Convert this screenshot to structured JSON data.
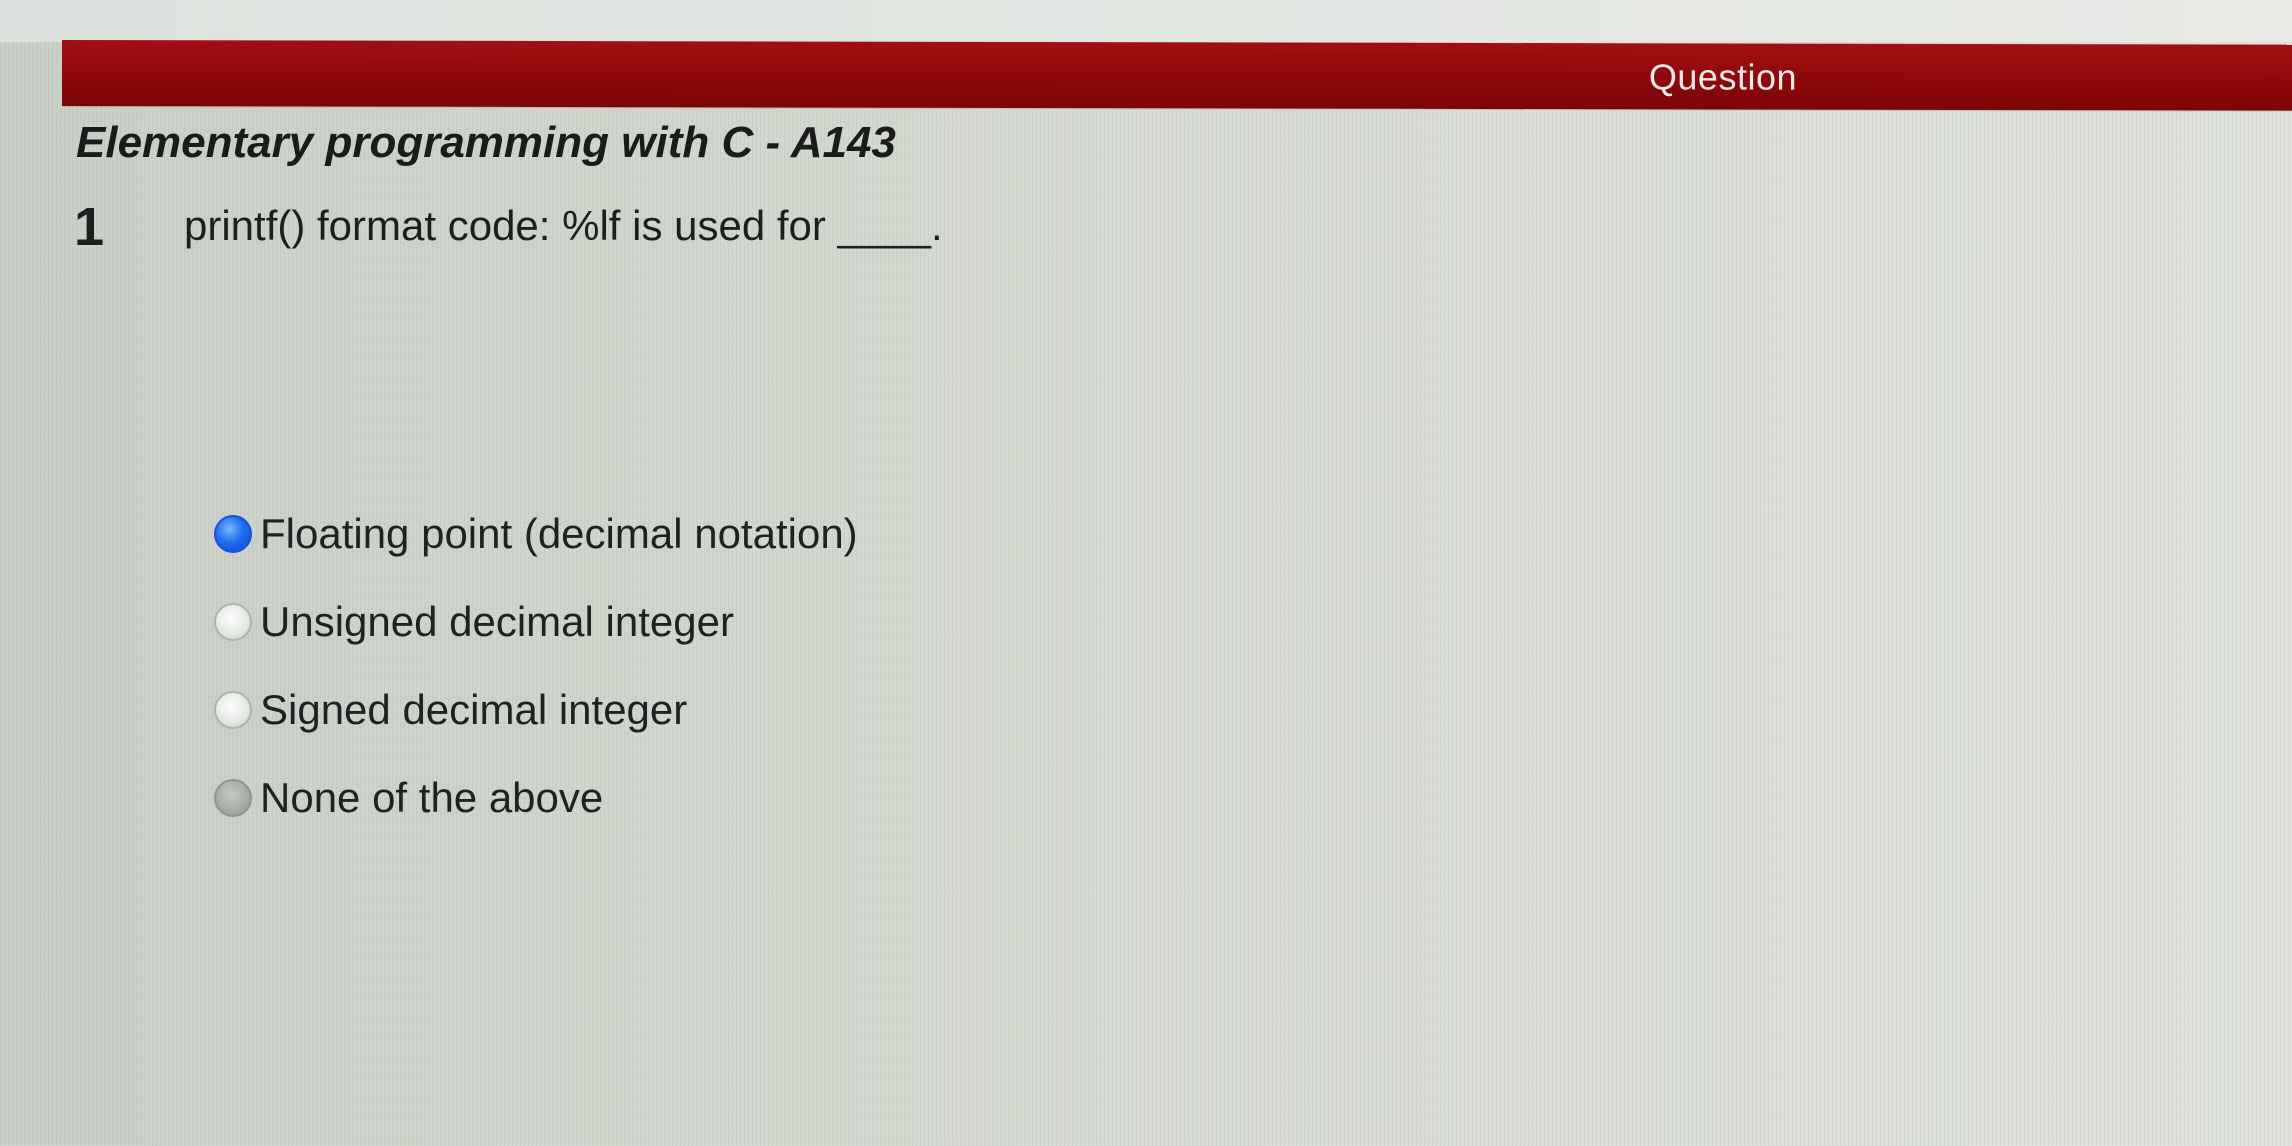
{
  "header": {
    "label": "Question"
  },
  "quiz": {
    "course_title": "Elementary programming with C - A143",
    "question_number": "1",
    "question_text": "printf() format code: %lf is used for ____.",
    "answers": [
      {
        "label": "Floating point (decimal notation)",
        "selected": true
      },
      {
        "label": "Unsigned decimal integer",
        "selected": false
      },
      {
        "label": "Signed decimal integer",
        "selected": false
      },
      {
        "label": "None of the above",
        "selected": false
      }
    ]
  },
  "colors": {
    "header_bar": "#8d080b",
    "selected_radio": "#1f6ff0",
    "background": "#d2d7ce"
  }
}
